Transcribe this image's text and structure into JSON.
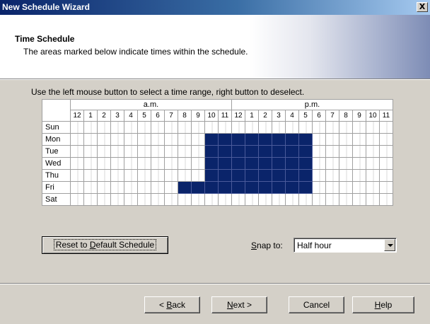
{
  "window": {
    "title": "New Schedule Wizard",
    "close_glyph": "X"
  },
  "header": {
    "title": "Time Schedule",
    "subtitle": "The areas marked below indicate times within the schedule."
  },
  "instruction": "Use the left mouse button to select a time range, right button to deselect.",
  "schedule": {
    "am_label": "a.m.",
    "pm_label": "p.m.",
    "hours": [
      "12",
      "1",
      "2",
      "3",
      "4",
      "5",
      "6",
      "7",
      "8",
      "9",
      "10",
      "11",
      "12",
      "1",
      "2",
      "3",
      "4",
      "5",
      "6",
      "7",
      "8",
      "9",
      "10",
      "11"
    ],
    "days": [
      {
        "name": "Sun",
        "selected_hours": []
      },
      {
        "name": "Mon",
        "selected_hours": [
          10,
          11,
          12,
          13,
          14,
          15,
          16,
          17
        ]
      },
      {
        "name": "Tue",
        "selected_hours": [
          10,
          11,
          12,
          13,
          14,
          15,
          16,
          17
        ]
      },
      {
        "name": "Wed",
        "selected_hours": [
          10,
          11,
          12,
          13,
          14,
          15,
          16,
          17
        ]
      },
      {
        "name": "Thu",
        "selected_hours": [
          10,
          11,
          12,
          13,
          14,
          15,
          16,
          17
        ]
      },
      {
        "name": "Fri",
        "selected_hours": [
          8,
          9,
          10,
          11,
          12,
          13,
          14,
          15,
          16,
          17
        ]
      },
      {
        "name": "Sat",
        "selected_hours": []
      }
    ],
    "selected_color": "#0a246a"
  },
  "reset_button": {
    "pre": "Reset to ",
    "accel": "D",
    "post": "efault Schedule"
  },
  "snap": {
    "label_accel": "S",
    "label_rest": "nap to:",
    "value": "Half hour"
  },
  "buttons": {
    "back": {
      "pre": "< ",
      "accel": "B",
      "post": "ack"
    },
    "next": {
      "pre": "",
      "accel": "N",
      "post": "ext >"
    },
    "cancel": "Cancel",
    "help": {
      "pre": "",
      "accel": "H",
      "post": "elp"
    }
  }
}
